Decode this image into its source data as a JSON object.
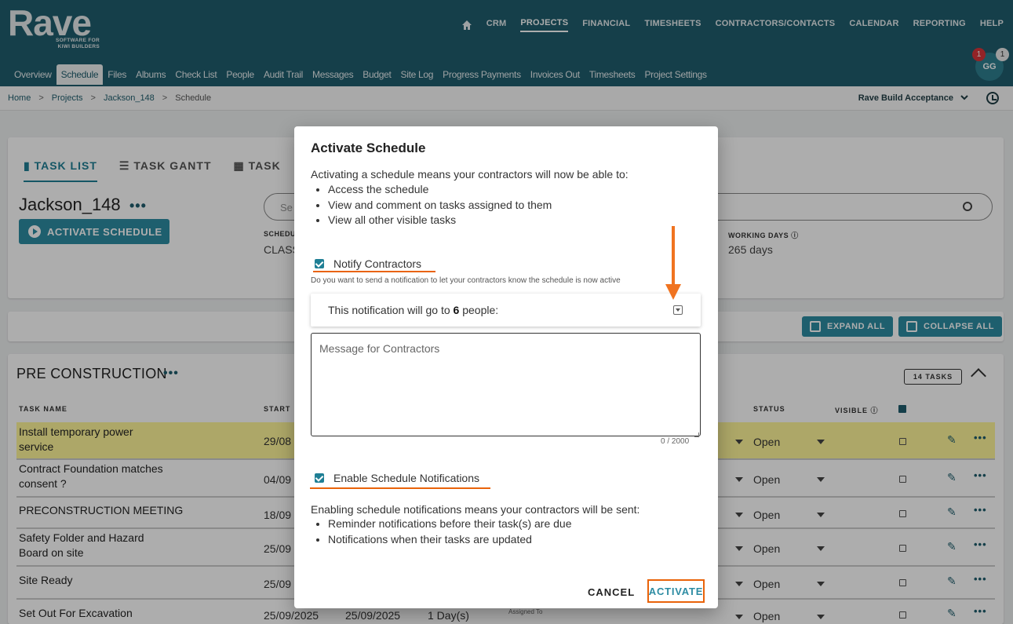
{
  "app": {
    "logo_word": "Rave",
    "logo_sub": "SOFTWARE FOR KIWI BUILDERS"
  },
  "topnav": [
    "CRM",
    "PROJECTS",
    "FINANCIAL",
    "TIMESHEETS",
    "CONTRACTORS/CONTACTS",
    "CALENDAR",
    "REPORTING",
    "HELP"
  ],
  "topnav_active": "PROJECTS",
  "tabs": [
    "Overview",
    "Schedule",
    "Files",
    "Albums",
    "Check List",
    "People",
    "Audit Trail",
    "Messages",
    "Budget",
    "Site Log",
    "Progress Payments",
    "Invoices Out",
    "Timesheets",
    "Project Settings"
  ],
  "tabs_active": "Schedule",
  "user": {
    "initials": "GG",
    "badge_red": "1",
    "badge_grey": "1"
  },
  "breadcrumb": {
    "home": "Home",
    "projects": "Projects",
    "project": "Jackson_148",
    "current": "Schedule",
    "sep": ">"
  },
  "environment": "Rave Build Acceptance",
  "view_tabs": {
    "task_list": "TASK LIST",
    "task_gantt": "TASK GANTT",
    "task_other": "TASK"
  },
  "project": {
    "title": "Jackson_148",
    "activate_button": "ACTIVATE SCHEDULE",
    "search_placeholder": "Se",
    "schedule_label": "SCHEDU",
    "schedule_value": "CLASS",
    "working_days_label": "WORKING DAYS",
    "working_days_value": "265 days"
  },
  "actions": {
    "expand_all": "EXPAND ALL",
    "collapse_all": "COLLAPSE ALL"
  },
  "section": {
    "title": "PRE CONSTRUCTION",
    "task_count": "14 TASKS",
    "headers": {
      "task_name": "TASK NAME",
      "start": "START",
      "status": "STATUS",
      "visible": "VISIBLE"
    }
  },
  "rows": [
    {
      "name": "Install temporary power\nservice",
      "start": "29/08",
      "status": "Open"
    },
    {
      "name": "Contract Foundation matches\nconsent ?",
      "start": "04/09",
      "status": "Open"
    },
    {
      "name": "PRECONSTRUCTION MEETING",
      "start": "18/09",
      "status": "Open"
    },
    {
      "name": "Safety Folder and Hazard\nBoard on site",
      "start": "25/09",
      "status": "Open"
    },
    {
      "name": "Site Ready",
      "start": "25/09",
      "status": "Open"
    },
    {
      "name": "Set Out For Excavation",
      "start": "25/09/2025",
      "end": "25/09/2025",
      "duration": "1 Day(s)",
      "assigned": "Assigned To",
      "status": "Open"
    }
  ],
  "dialog": {
    "title": "Activate Schedule",
    "intro": "Activating a schedule means your contractors will now be able to:",
    "abilities": [
      "Access the schedule",
      "View and comment on tasks assigned to them",
      "View all other visible tasks"
    ],
    "notify_label": "Notify Contractors",
    "notify_hint": "Do you want to send a notification to let your contractors know the schedule is now active",
    "notify_prefix": "This notification will go to ",
    "notify_count": "6",
    "notify_suffix": " people:",
    "message_placeholder": "Message for Contractors",
    "message_counter": "0 / 2000",
    "enable_label": "Enable Schedule Notifications",
    "enable_intro": "Enabling schedule notifications means your contractors will be sent:",
    "enable_items": [
      "Reminder notifications before their task(s) are due",
      "Notifications when their tasks are updated"
    ],
    "cancel": "CANCEL",
    "activate": "ACTIVATE"
  },
  "colors": {
    "header": "#1f5e6d",
    "accent": "#2d8ca3",
    "highlight": "#fff69a",
    "annotation": "#e9630a"
  }
}
